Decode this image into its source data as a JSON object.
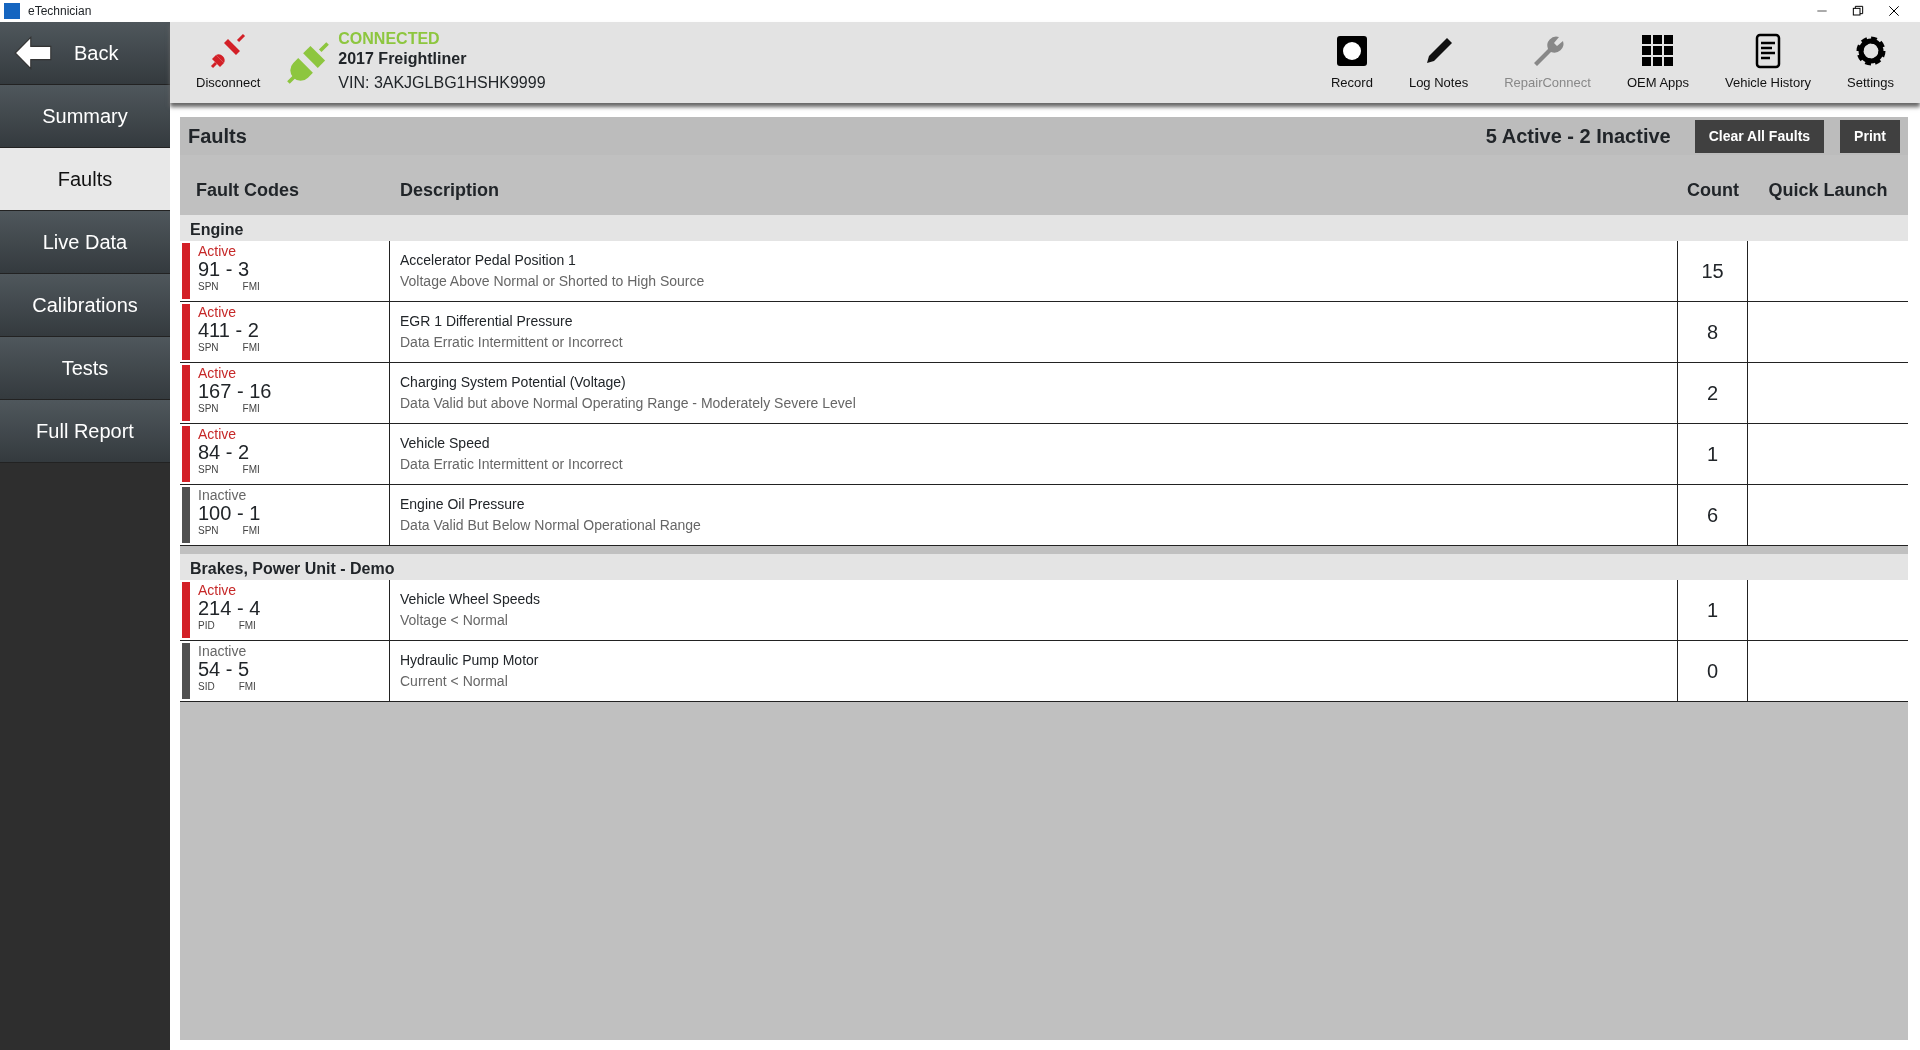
{
  "window": {
    "title": "eTechnician"
  },
  "sidebar": {
    "back": "Back",
    "items": [
      {
        "label": "Summary",
        "selected": false
      },
      {
        "label": "Faults",
        "selected": true
      },
      {
        "label": "Live Data",
        "selected": false
      },
      {
        "label": "Calibrations",
        "selected": false
      },
      {
        "label": "Tests",
        "selected": false
      },
      {
        "label": "Full Report",
        "selected": false
      }
    ]
  },
  "toolbar": {
    "disconnect": "Disconnect",
    "connection": {
      "status": "CONNECTED",
      "vehicle": "2017 Freightliner",
      "vin": "VIN: 3AKJGLBG1HSHK9999"
    },
    "buttons": [
      {
        "kind": "record",
        "label": "Record",
        "disabled": false
      },
      {
        "kind": "pencil",
        "label": "Log Notes",
        "disabled": false
      },
      {
        "kind": "wrench",
        "label": "RepairConnect",
        "disabled": true
      },
      {
        "kind": "grid",
        "label": "OEM Apps",
        "disabled": false
      },
      {
        "kind": "document",
        "label": "Vehicle History",
        "disabled": false
      },
      {
        "kind": "gear",
        "label": "Settings",
        "disabled": false
      }
    ]
  },
  "faults_header": {
    "title": "Faults",
    "summary": "5 Active - 2 Inactive",
    "buttons": [
      "Clear All Faults",
      "Print"
    ]
  },
  "table": {
    "columns": [
      "Fault Codes",
      "Description",
      "Count",
      "Quick Launch"
    ],
    "groups": [
      {
        "name": "Engine",
        "rows": [
          {
            "status": "Active",
            "active": true,
            "code": "91 - 3",
            "code_labels": [
              "SPN",
              "FMI"
            ],
            "title": "Accelerator Pedal Position 1",
            "detail": "Voltage Above Normal or Shorted to High Source",
            "count": "15"
          },
          {
            "status": "Active",
            "active": true,
            "code": "411 - 2",
            "code_labels": [
              "SPN",
              "FMI"
            ],
            "title": "EGR 1 Differential Pressure",
            "detail": "Data Erratic Intermittent or Incorrect",
            "count": "8"
          },
          {
            "status": "Active",
            "active": true,
            "code": "167 - 16",
            "code_labels": [
              "SPN",
              "FMI"
            ],
            "title": "Charging System Potential (Voltage)",
            "detail": "Data Valid but above Normal Operating Range - Moderately Severe Level",
            "count": "2"
          },
          {
            "status": "Active",
            "active": true,
            "code": "84 - 2",
            "code_labels": [
              "SPN",
              "FMI"
            ],
            "title": "Vehicle Speed",
            "detail": "Data Erratic Intermittent or Incorrect",
            "count": "1"
          },
          {
            "status": "Inactive",
            "active": false,
            "code": "100 - 1",
            "code_labels": [
              "SPN",
              "FMI"
            ],
            "title": "Engine Oil Pressure",
            "detail": "Data Valid But Below Normal Operational Range",
            "count": "6"
          }
        ]
      },
      {
        "name": "Brakes, Power Unit - Demo",
        "rows": [
          {
            "status": "Active",
            "active": true,
            "code": "214 - 4",
            "code_labels": [
              "PID",
              "FMI"
            ],
            "title": "Vehicle Wheel Speeds",
            "detail": "Voltage < Normal",
            "count": "1"
          },
          {
            "status": "Inactive",
            "active": false,
            "code": "54 - 5",
            "code_labels": [
              "SID",
              "FMI"
            ],
            "title": "Hydraulic Pump Motor",
            "detail": "Current < Normal",
            "count": "0"
          }
        ]
      }
    ]
  }
}
